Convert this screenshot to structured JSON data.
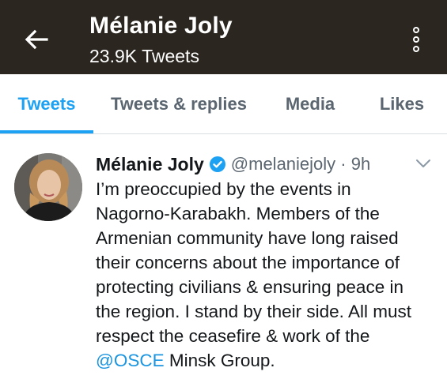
{
  "header": {
    "name": "Mélanie Joly",
    "tweet_count": "23.9K Tweets",
    "back_icon": "arrow-left-icon",
    "menu_icon": "more-vertical-icon"
  },
  "tabs": [
    {
      "label": "Tweets",
      "active": true
    },
    {
      "label": "Tweets & replies",
      "active": false
    },
    {
      "label": "Media",
      "active": false
    },
    {
      "label": "Likes",
      "active": false
    }
  ],
  "tweet": {
    "author": "Mélanie Joly",
    "verified": true,
    "handle_time": "@melaniejoly · 9h",
    "text_lines": [
      "I’m preoccupied by the events in",
      "Nagorno-Karabakh. Members of the",
      "Armenian community have long raised",
      "their concerns about the importance of",
      "protecting civilians & ensuring peace in",
      "the region. I stand by their side. All must",
      "respect the ceasefire & work of the"
    ],
    "last_line_mention": "@OSCE",
    "last_line_rest": " Minsk Group."
  },
  "colors": {
    "accent": "#1da1f2",
    "header_bg": "#2b261f",
    "muted": "#5b6670"
  }
}
